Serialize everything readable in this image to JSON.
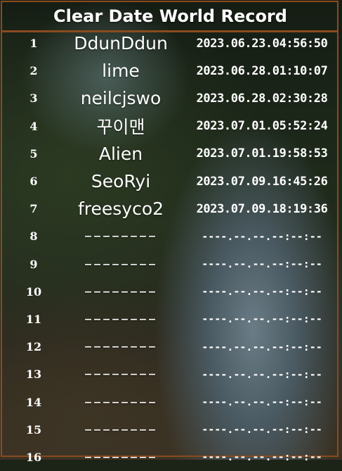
{
  "title": "Clear Date World Record",
  "records": [
    {
      "rank": "1",
      "name": "DdunDdun",
      "date": "2023.06.23.04:56:50"
    },
    {
      "rank": "2",
      "name": "lime",
      "date": "2023.06.28.01:10:07"
    },
    {
      "rank": "3",
      "name": "neilcjswo",
      "date": "2023.06.28.02:30:28"
    },
    {
      "rank": "4",
      "name": "꾸이맨",
      "date": "2023.07.01.05:52:24"
    },
    {
      "rank": "5",
      "name": "Alien",
      "date": "2023.07.01.19:58:53"
    },
    {
      "rank": "6",
      "name": "SeoRyi",
      "date": "2023.07.09.16:45:26"
    },
    {
      "rank": "7",
      "name": "freesyco2",
      "date": "2023.07.09.18:19:36"
    },
    {
      "rank": "8",
      "name": "––––––––",
      "date": "----.--.--.--:--:--"
    },
    {
      "rank": "9",
      "name": "––––––––",
      "date": "----.--.--.--:--:--"
    },
    {
      "rank": "10",
      "name": "––––––––",
      "date": "----.--.--.--:--:--"
    },
    {
      "rank": "11",
      "name": "––––––––",
      "date": "----.--.--.--:--:--"
    },
    {
      "rank": "12",
      "name": "––––––––",
      "date": "----.--.--.--:--:--"
    },
    {
      "rank": "13",
      "name": "––––––––",
      "date": "----.--.--.--:--:--"
    },
    {
      "rank": "14",
      "name": "––––––––",
      "date": "----.--.--.--:--:--"
    },
    {
      "rank": "15",
      "name": "––––––––",
      "date": "----.--.--.--:--:--"
    },
    {
      "rank": "16",
      "name": "––––––––",
      "date": "----.--.--.--:--:--"
    }
  ],
  "colors": {
    "frame": "#8a4b1f",
    "text": "#ffffff"
  }
}
